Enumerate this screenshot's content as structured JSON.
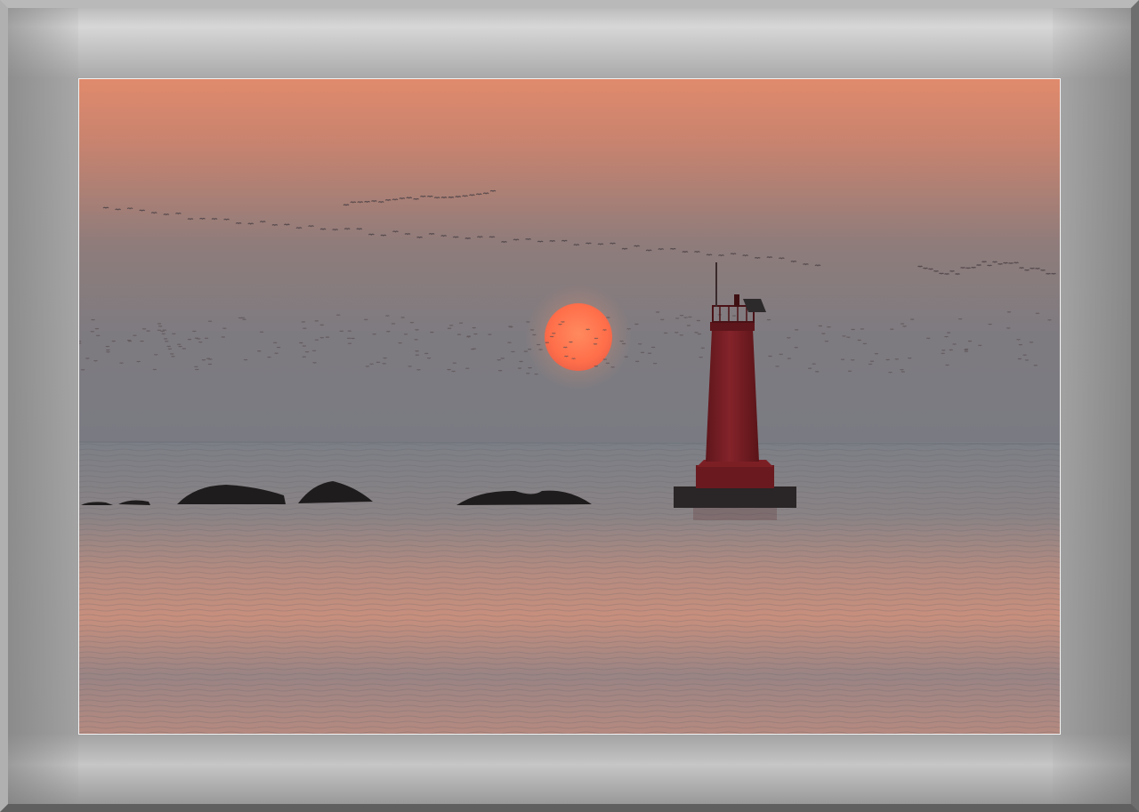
{
  "scene": {
    "subject": "lighthouse-at-sunset",
    "colors": {
      "sky_top": "#e08a6c",
      "sky_mid": "#8f7c7b",
      "sky_horizon": "#7b7b81",
      "sea": "#7d7e84",
      "sea_glow": "#d79479",
      "sun": "#ff7a52",
      "lighthouse": "#7a1d22",
      "rocks": "#1f1c1d",
      "frame": "#a4a4a4",
      "mat_border": "#f2f2f2"
    }
  }
}
